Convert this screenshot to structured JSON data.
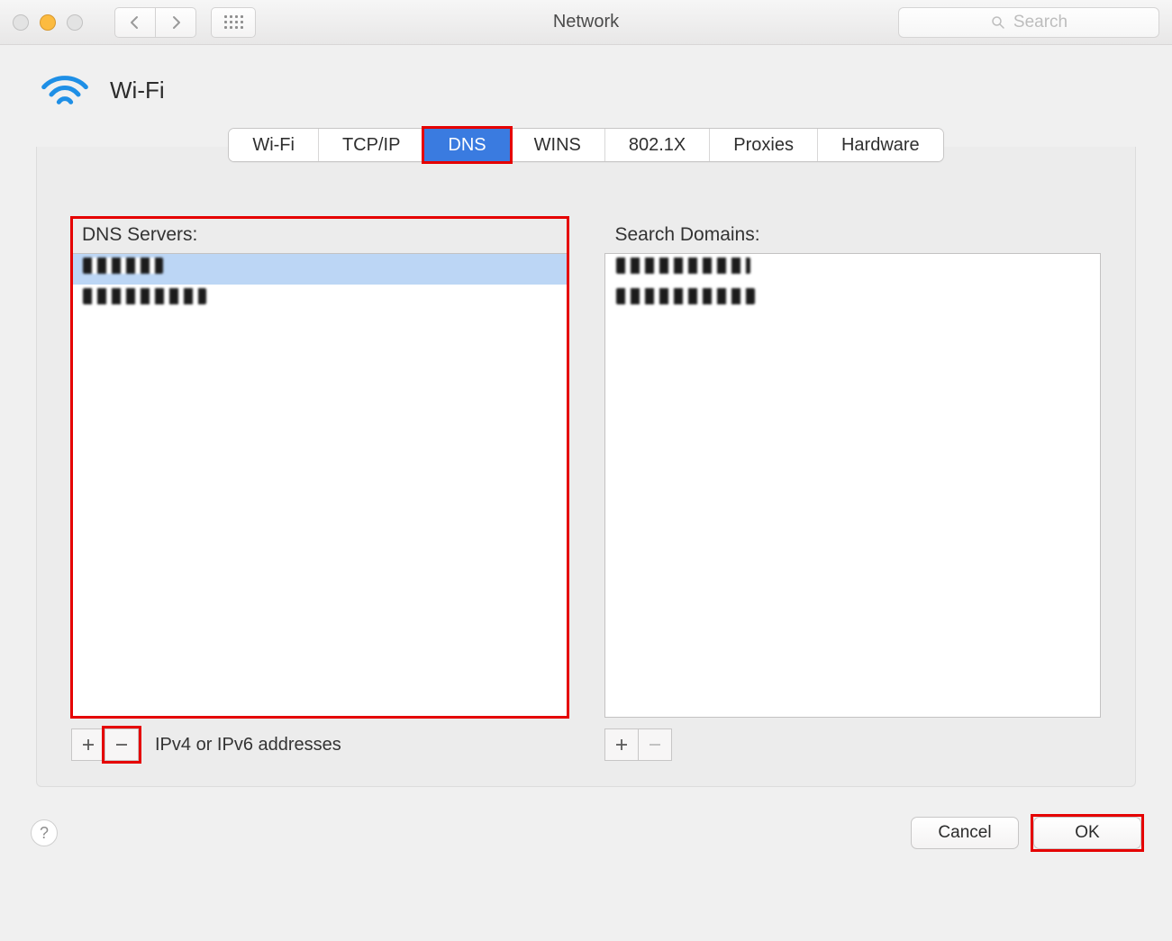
{
  "window": {
    "title": "Network"
  },
  "search": {
    "placeholder": "Search"
  },
  "interface": {
    "name": "Wi-Fi"
  },
  "tabs": [
    {
      "label": "Wi-Fi",
      "active": false
    },
    {
      "label": "TCP/IP",
      "active": false
    },
    {
      "label": "DNS",
      "active": true
    },
    {
      "label": "WINS",
      "active": false
    },
    {
      "label": "802.1X",
      "active": false
    },
    {
      "label": "Proxies",
      "active": false
    },
    {
      "label": "Hardware",
      "active": false
    }
  ],
  "dns": {
    "header": "DNS Servers:",
    "footer_hint": "IPv4 or IPv6 addresses",
    "servers": [
      {
        "value": "",
        "redacted": true,
        "selected": true
      },
      {
        "value": "",
        "redacted": true,
        "selected": false
      }
    ]
  },
  "search_domains": {
    "header": "Search Domains:",
    "items": [
      {
        "value": "",
        "redacted": true
      },
      {
        "value": "",
        "redacted": true
      }
    ]
  },
  "buttons": {
    "cancel": "Cancel",
    "ok": "OK"
  }
}
